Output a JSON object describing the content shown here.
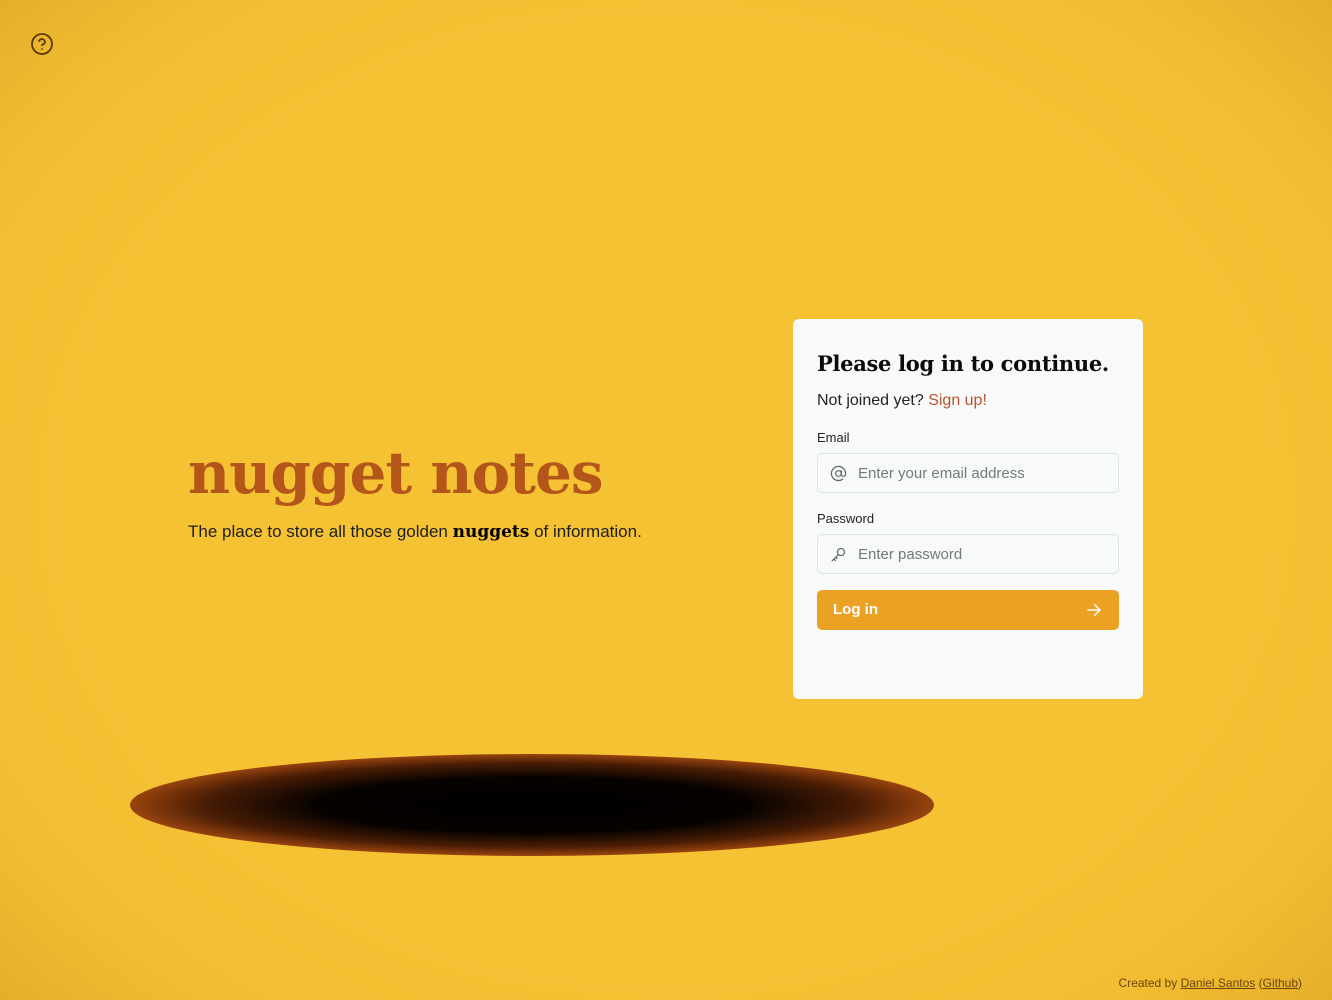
{
  "help": {
    "icon": "help-circle-icon"
  },
  "hero": {
    "title": "nugget notes",
    "tagline_before": "The place to store all those golden ",
    "tagline_emphasis": "nuggets",
    "tagline_after": " of information."
  },
  "login_card": {
    "title": "Please log in to continue.",
    "signup_prompt": "Not joined yet?",
    "signup_link": "Sign up!",
    "email_label": "Email",
    "email_placeholder": "Enter your email address",
    "email_icon": "at-sign-icon",
    "password_label": "Password",
    "password_placeholder": "Enter password",
    "password_icon": "key-icon",
    "submit_label": "Log in",
    "submit_icon": "arrow-right-icon"
  },
  "footer": {
    "prefix": "Created by ",
    "author_link": "Daniel Santos",
    "open_paren": " (",
    "github_link": "Github",
    "close_paren": ")"
  },
  "colors": {
    "background": "#f5c234",
    "brand_title": "#b4561a",
    "card_bg": "#f7faf9",
    "button_bg": "#eba123",
    "signup_link": "#b45633",
    "footer_text": "#6b4410"
  }
}
